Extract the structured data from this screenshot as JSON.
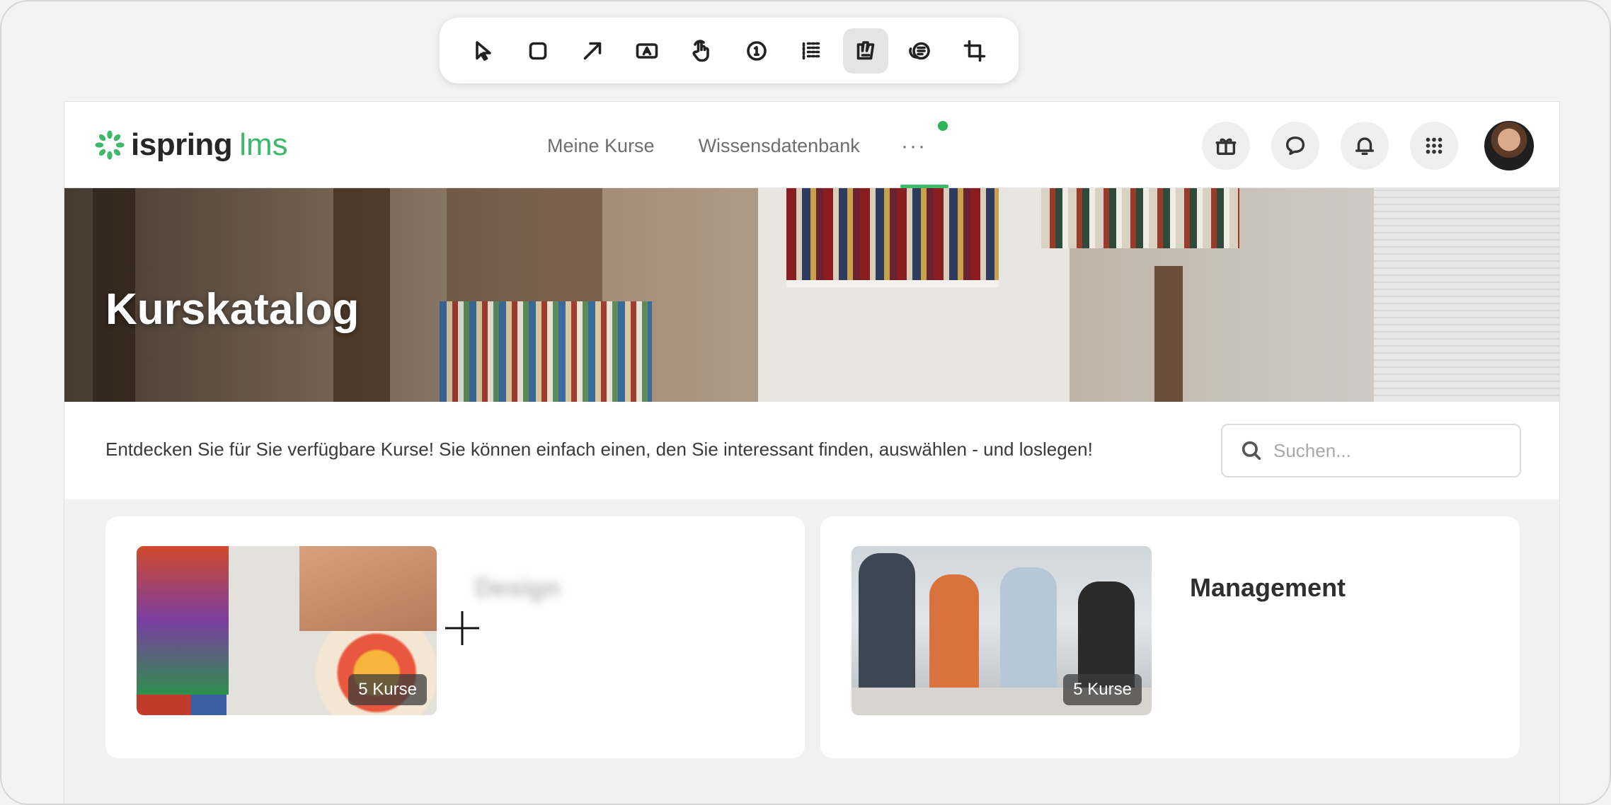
{
  "toolbar": {
    "tools": [
      {
        "name": "select-tool",
        "active": false
      },
      {
        "name": "rectangle-tool",
        "active": false
      },
      {
        "name": "arrow-tool",
        "active": false
      },
      {
        "name": "text-tool",
        "active": false
      },
      {
        "name": "click-tool",
        "active": false
      },
      {
        "name": "number-tool",
        "active": false
      },
      {
        "name": "blur-tool",
        "active": false
      },
      {
        "name": "highlight-tool",
        "active": true
      },
      {
        "name": "spotlight-tool",
        "active": false
      },
      {
        "name": "crop-tool",
        "active": false
      }
    ]
  },
  "header": {
    "logo_brand": "ispring",
    "logo_product": "lms",
    "nav": [
      "Meine Kurse",
      "Wissensdatenbank"
    ],
    "more_label": "···",
    "icons": [
      "gift-icon",
      "chat-icon",
      "bell-icon",
      "apps-grid-icon"
    ]
  },
  "hero": {
    "title": "Kurskatalog"
  },
  "intro": {
    "text": "Entdecken Sie für Sie verfügbare Kurse! Sie können einfach einen, den Sie interessant finden, auswählen - und loslegen!"
  },
  "search": {
    "placeholder": "Suchen..."
  },
  "categories": [
    {
      "title": "Design",
      "count_label": "5 Kurse",
      "blurred": true
    },
    {
      "title": "Management",
      "count_label": "5 Kurse",
      "blurred": false
    }
  ],
  "colors": {
    "brand_green": "#3eb96a",
    "notification_dot": "#2db45a",
    "page_background": "#f1f1f1"
  }
}
